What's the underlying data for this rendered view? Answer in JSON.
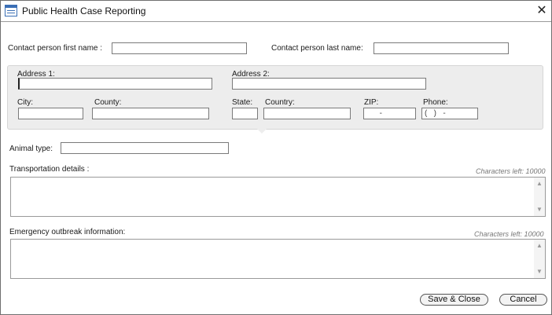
{
  "window": {
    "title": "Public Health Case Reporting",
    "close_glyph": "✕"
  },
  "contact": {
    "first_name_label": "Contact person first name :",
    "first_name_value": "",
    "last_name_label": "Contact person last name:",
    "last_name_value": ""
  },
  "address": {
    "address1_label": "Address 1:",
    "address1_value": "",
    "address2_label": "Address 2:",
    "address2_value": "",
    "city_label": "City:",
    "city_value": "",
    "county_label": "County:",
    "county_value": "",
    "state_label": "State:",
    "state_value": "",
    "country_label": "Country:",
    "country_value": "",
    "zip_label": "ZIP:",
    "zip_mask": "      -",
    "phone_label": "Phone:",
    "phone_mask": "(   )   -"
  },
  "animal": {
    "label": "Animal type:",
    "value": ""
  },
  "transportation": {
    "label": "Transportation details :",
    "chars_left": "Characters left: 10000",
    "value": ""
  },
  "emergency": {
    "label": "Emergency outbreak information:",
    "chars_left": "Characters left: 10000",
    "value": ""
  },
  "scroll_glyphs": {
    "up": "▲",
    "down": "▼"
  },
  "buttons": {
    "save_close": "Save & Close",
    "cancel": "Cancel"
  }
}
